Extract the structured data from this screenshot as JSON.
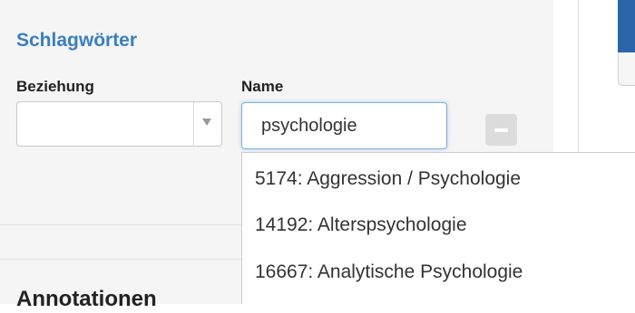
{
  "keywords": {
    "title": "Schlagwörter",
    "relation_label": "Beziehung",
    "name_label": "Name",
    "relation_value": "",
    "name_value": "psychologie",
    "remove_label": "−",
    "suggestions": [
      {
        "label": "5174: Aggression / Psychologie"
      },
      {
        "label": "14192: Alterspsychologie"
      },
      {
        "label": "16667: Analytische Psychologie"
      }
    ]
  },
  "next_section": {
    "title": "Annotationen"
  },
  "colors": {
    "section_title": "#3a7fc0",
    "input_focus_border": "#7ab0e0",
    "remove_button": "#dcdcdc",
    "accent_bar": "#2a66a8"
  },
  "icons": {
    "select_arrow": "chevron-down-icon",
    "remove": "minus-icon"
  }
}
